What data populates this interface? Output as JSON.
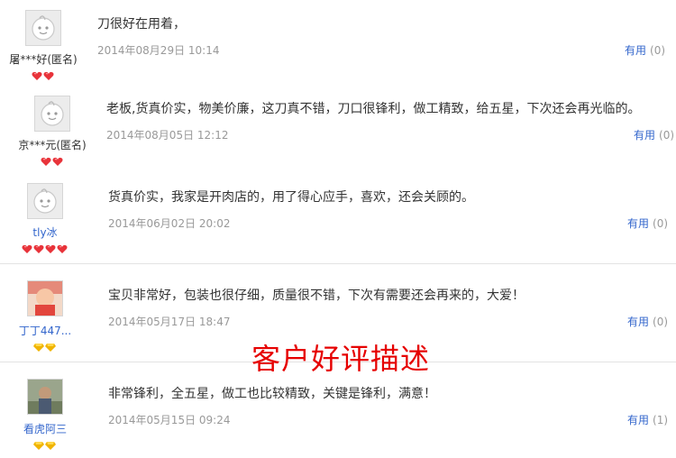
{
  "reviews": [
    {
      "username": "屠***好(匿名)",
      "content": "刀很好在用着，",
      "date": "2014年08月29日 10:14",
      "useful_label": "有用",
      "useful_count": "(0)",
      "avatar": "default-face-icon",
      "badge": "red-heart-icon",
      "badge_count": 2
    },
    {
      "username": "京***元(匿名)",
      "content": "老板,货真价实，物美价廉，这刀真不错，刀口很锋利，做工精致，给五星，下次还会再光临的。",
      "date": "2014年08月05日 12:12",
      "useful_label": "有用",
      "useful_count": "(0)",
      "avatar": "default-face-icon",
      "badge": "red-heart-icon",
      "badge_count": 2
    },
    {
      "username": "tly冰",
      "content": "货真价实，我家是开肉店的，用了得心应手，喜欢，还会关顾的。",
      "date": "2014年06月02日 20:02",
      "useful_label": "有用",
      "useful_count": "(0)",
      "avatar": "default-face-icon",
      "badge": "red-heart-icon",
      "badge_count": 4
    },
    {
      "username": "丁丁447...",
      "content": "宝贝非常好，包装也很仔细，质量很不错，下次有需要还会再来的，大爱！",
      "date": "2014年05月17日 18:47",
      "useful_label": "有用",
      "useful_count": "(0)",
      "avatar": "baby-photo-avatar",
      "badge": "gold-diamond-icon",
      "badge_count": 2
    },
    {
      "username": "看虎阿三",
      "content": "非常锋利，全五星，做工也比较精致，关键是锋利，满意！",
      "date": "2014年05月15日 09:24",
      "useful_label": "有用",
      "useful_count": "(1)",
      "avatar": "person-photo-avatar",
      "badge": "gold-diamond-icon",
      "badge_count": 2
    }
  ],
  "overlay_caption": "客户好评描述",
  "colors": {
    "link": "#3366cc",
    "meta": "#999999",
    "caption": "#e60000",
    "heart": "#e8333a",
    "diamond": "#f0b400"
  }
}
